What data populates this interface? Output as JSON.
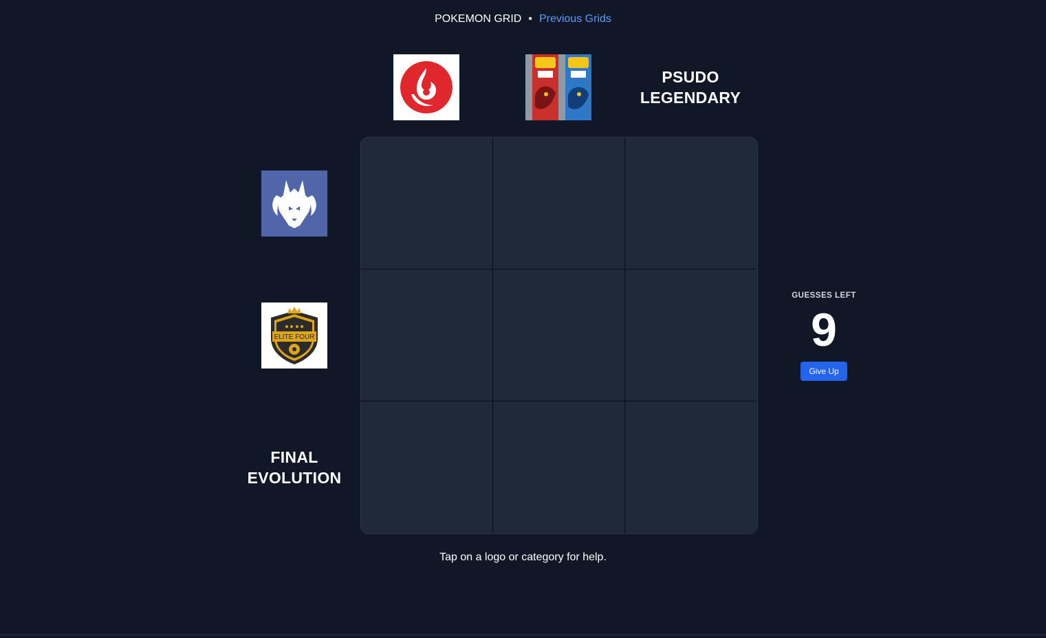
{
  "nav": {
    "title": "POKEMON GRID",
    "separator": "•",
    "previous_link": "Previous Grids"
  },
  "columns": [
    {
      "kind": "logo",
      "icon": "fire-type-icon",
      "bg": "#ffffff",
      "accent": "#e0282c"
    },
    {
      "kind": "logo",
      "icon": "ruby-sapphire-boxart",
      "bg": "#ffffff"
    },
    {
      "kind": "text",
      "label": "PSUDO\nLEGENDARY"
    }
  ],
  "rows": [
    {
      "kind": "logo",
      "icon": "dragon-type-icon",
      "bg": "#5166a8"
    },
    {
      "kind": "logo",
      "icon": "elite-four-badge",
      "bg": "#ffffff",
      "badge_text": "ELITE FOUR"
    },
    {
      "kind": "text",
      "label": "FINAL\nEVOLUTION"
    }
  ],
  "status": {
    "guesses_label": "GUESSES LEFT",
    "guesses_left": "9",
    "give_up_label": "Give Up"
  },
  "help_text": "Tap on a logo or category for help.",
  "colors": {
    "background": "#101727",
    "cell": "#1f2937",
    "link": "#5b9bf5",
    "button": "#2463eb"
  }
}
